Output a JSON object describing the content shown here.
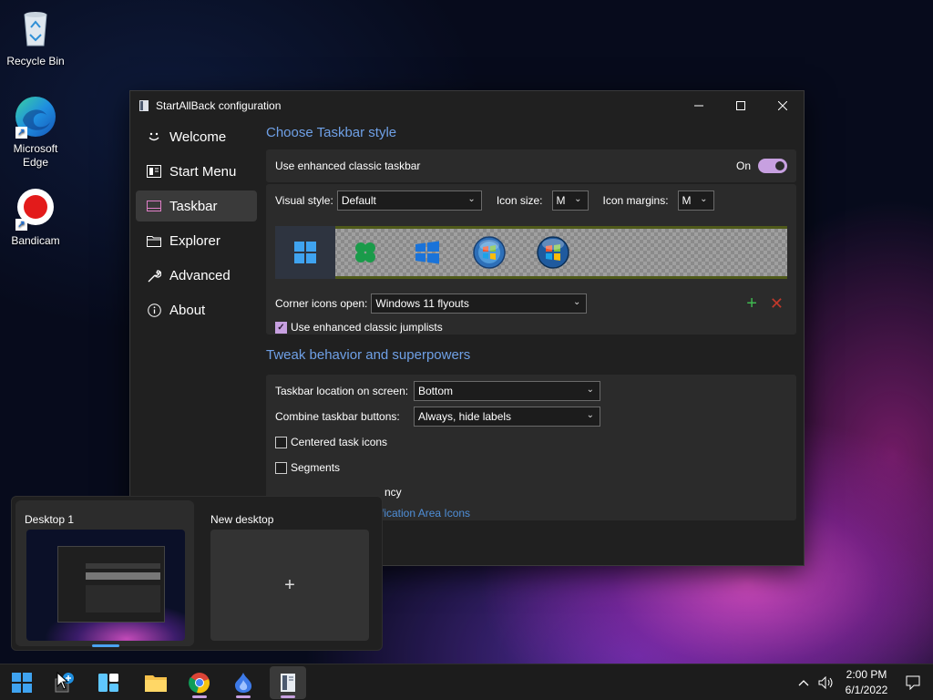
{
  "desktop": {
    "icons": [
      {
        "label": "Recycle Bin"
      },
      {
        "label": "Microsoft\nEdge"
      },
      {
        "label": "Bandicam"
      }
    ]
  },
  "window": {
    "title": "StartAllBack configuration",
    "sidebar": [
      {
        "label": "Welcome",
        "icon": "smiley-icon"
      },
      {
        "label": "Start Menu",
        "icon": "start-menu-icon"
      },
      {
        "label": "Taskbar",
        "icon": "taskbar-icon",
        "active": true
      },
      {
        "label": "Explorer",
        "icon": "folder-icon"
      },
      {
        "label": "Advanced",
        "icon": "wrench-icon"
      },
      {
        "label": "About",
        "icon": "info-icon"
      }
    ],
    "section1": {
      "title": "Choose Taskbar style",
      "enhanced_label": "Use enhanced classic taskbar",
      "toggle_state": "On",
      "visual_style_label": "Visual style:",
      "visual_style_value": "Default",
      "icon_size_label": "Icon size:",
      "icon_size_value": "M",
      "icon_margins_label": "Icon margins:",
      "icon_margins_value": "M",
      "corner_label": "Corner icons open:",
      "corner_value": "Windows 11 flyouts",
      "jumplists_label": "Use enhanced classic jumplists"
    },
    "section2": {
      "title": "Tweak behavior and superpowers",
      "location_label": "Taskbar location on screen:",
      "location_value": "Bottom",
      "combine_label": "Combine taskbar buttons:",
      "combine_value": "Always, hide labels",
      "centered_label": "Centered task icons",
      "segments_label": "Segments",
      "partial_label": "ncy",
      "link_partial": "tification Area Icons"
    }
  },
  "taskview": {
    "desktop1": "Desktop 1",
    "new_desktop": "New desktop",
    "plus": "+"
  },
  "tray": {
    "time": "2:00 PM",
    "date": "6/1/2022"
  },
  "colors": {
    "accent": "#c7a0e0",
    "link": "#6fa0e6"
  }
}
